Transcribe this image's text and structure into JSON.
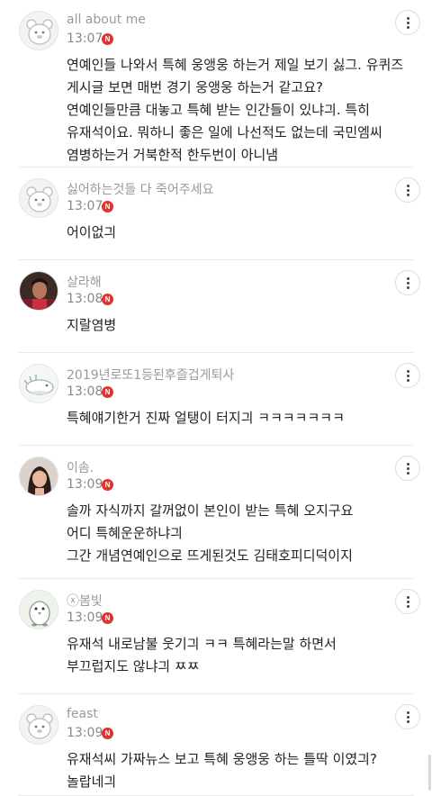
{
  "comments": [
    {
      "nickname": "all about me",
      "time": "13:07",
      "badge": "N",
      "avatar": "bear-icon",
      "lines": [
        "연예인들 나와서 특혜 웅앵웅 하는거 제일 보기 싫그. 유퀴즈",
        "게시글 보면 매번 경기 웅앵웅 하는거 같고요?",
        "연예인들만큼 대놓고 특혜 받는 인간들이 있냐긔. 특히",
        "유재석이요. 뭐하니 좋은 일에 나선적도 없는데 국민엠씨",
        "염병하는거 거북한적 한두번이 아니냄"
      ]
    },
    {
      "nickname": "싫어하는것들 다 죽어주세요",
      "time": "13:07",
      "badge": "N",
      "avatar": "bear-icon",
      "lines": [
        "어이없긔"
      ]
    },
    {
      "nickname": "살라해",
      "time": "13:08",
      "badge": "N",
      "avatar": "person-photo",
      "lines": [
        "지랄염병"
      ]
    },
    {
      "nickname": "2019년로또1등된후즐겁게퇴사",
      "time": "13:08",
      "badge": "N",
      "avatar": "creature-icon",
      "lines": [
        "특혜얘기한거 진짜 얼탱이 터지긔 ㅋㅋㅋㅋㅋㅋㅋ"
      ]
    },
    {
      "nickname": "이솜.",
      "time": "13:09",
      "badge": "N",
      "avatar": "woman-photo",
      "lines": [
        "솔까 자식까지 갈꺼없이 본인이 받는 특혜 오지구요",
        "어디 특혜운운하냐긔",
        "그간 개념연예인으로 뜨게된것도 김태호피디덕이지"
      ]
    },
    {
      "nickname": "ⓧ봄빛",
      "time": "13:09",
      "badge": "N",
      "avatar": "penguin-icon",
      "lines": [
        "유재석 내로남불 웃기긔 ㅋㅋ 특혜라는말 하면서",
        "부끄럽지도 않냐긔 ㅉㅉ"
      ]
    },
    {
      "nickname": "feast",
      "time": "13:09",
      "badge": "N",
      "avatar": "bear-icon",
      "lines": [
        "유재석씨 가짜뉴스 보고 특혜 웅앵웅 하는 틀딱 이였긔?",
        "놀랍네긔"
      ]
    }
  ],
  "colors": {
    "badge": "#e0342e",
    "nickname": "#999999",
    "body_text": "#222222",
    "divider": "#ececec"
  }
}
